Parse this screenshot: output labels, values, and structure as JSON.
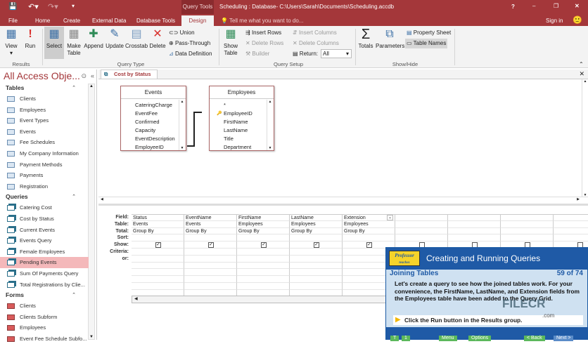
{
  "title": {
    "query_tools": "Query Tools",
    "window_title": "Scheduling : Database- C:\\Users\\Sarah\\Documents\\Scheduling.accdb",
    "help": "?",
    "minimize": "–",
    "restore": "❐",
    "close": "✕",
    "sign_in": "Sign in"
  },
  "tabs": [
    "File",
    "Home",
    "Create",
    "External Data",
    "Database Tools",
    "Design"
  ],
  "tell_me": "Tell me what you want to do...",
  "ribbon": {
    "results": {
      "label": "Results",
      "view": "View",
      "run": "Run"
    },
    "query_type": {
      "label": "Query Type",
      "select": "Select",
      "make_table": "Make Table",
      "append": "Append",
      "update": "Update",
      "crosstab": "Crosstab",
      "delete": "Delete",
      "union": "Union",
      "pass_through": "Pass-Through",
      "data_definition": "Data Definition"
    },
    "query_setup": {
      "label": "Query Setup",
      "show_table": "Show Table",
      "insert_rows": "Insert Rows",
      "delete_rows": "Delete Rows",
      "builder": "Builder",
      "insert_columns": "Insert Columns",
      "delete_columns": "Delete Columns",
      "return_label": "Return:",
      "return_value": "All"
    },
    "show_hide": {
      "label": "Show/Hide",
      "totals": "Totals",
      "parameters": "Parameters",
      "property_sheet": "Property Sheet",
      "table_names": "Table Names"
    }
  },
  "nav": {
    "title": "All Access Obje...",
    "tables_header": "Tables",
    "tables": [
      "Clients",
      "Employees",
      "Event Types",
      "Events",
      "Fee Schedules",
      "My Company Information",
      "Payment Methods",
      "Payments",
      "Registration"
    ],
    "queries_header": "Queries",
    "queries": [
      "Catering Cost",
      "Cost by Status",
      "Current Events",
      "Events Query",
      "Female Employees",
      "Pending Events",
      "Sum Of Payments Query",
      "Total Registrations by Clie..."
    ],
    "forms_header": "Forms",
    "forms": [
      "Clients",
      "Clients Subform",
      "Employees",
      "Event Fee Schedule Subfo..."
    ]
  },
  "doc_tab": "Cost by Status",
  "tables": {
    "events": {
      "name": "Events",
      "fields": [
        "CateringCharge",
        "EventFee",
        "Confirmed",
        "Capacity",
        "EventDescription",
        "EmployeeID"
      ]
    },
    "employees": {
      "name": "Employees",
      "fields": [
        "*",
        "EmployeeID",
        "FirstName",
        "LastName",
        "Title",
        "Department"
      ]
    }
  },
  "grid": {
    "row_labels": [
      "Field:",
      "Table:",
      "Total:",
      "Sort:",
      "Show:",
      "Criteria:",
      "or:"
    ],
    "columns": [
      {
        "field": "Status",
        "table": "Events",
        "total": "Group By",
        "show": true
      },
      {
        "field": "EventName",
        "table": "Events",
        "total": "Group By",
        "show": true
      },
      {
        "field": "FirstName",
        "table": "Employees",
        "total": "Group By",
        "show": true
      },
      {
        "field": "LastName",
        "table": "Employees",
        "total": "Group By",
        "show": true
      },
      {
        "field": "Extension",
        "table": "Employees",
        "total": "Group By",
        "show": true
      }
    ]
  },
  "tutorial": {
    "logo": "Professor Teaches",
    "title": "Creating and Running Queries",
    "lesson": "Joining Tables",
    "progress": "59 of 74",
    "body": "Let's create a query to see how the joined tables work. For your convenience, the FirstName, LastName, and Extension fields from the Employees table have been added to the Query Grid.",
    "instruction": "Click the Run button in the Results group.",
    "buttons": {
      "t": "T",
      "one": "1",
      "menu": "Menu",
      "options": "Options",
      "back": "< Back",
      "next": "Next >"
    }
  },
  "watermark": {
    "text": "FILECR",
    "sub": ".com"
  }
}
